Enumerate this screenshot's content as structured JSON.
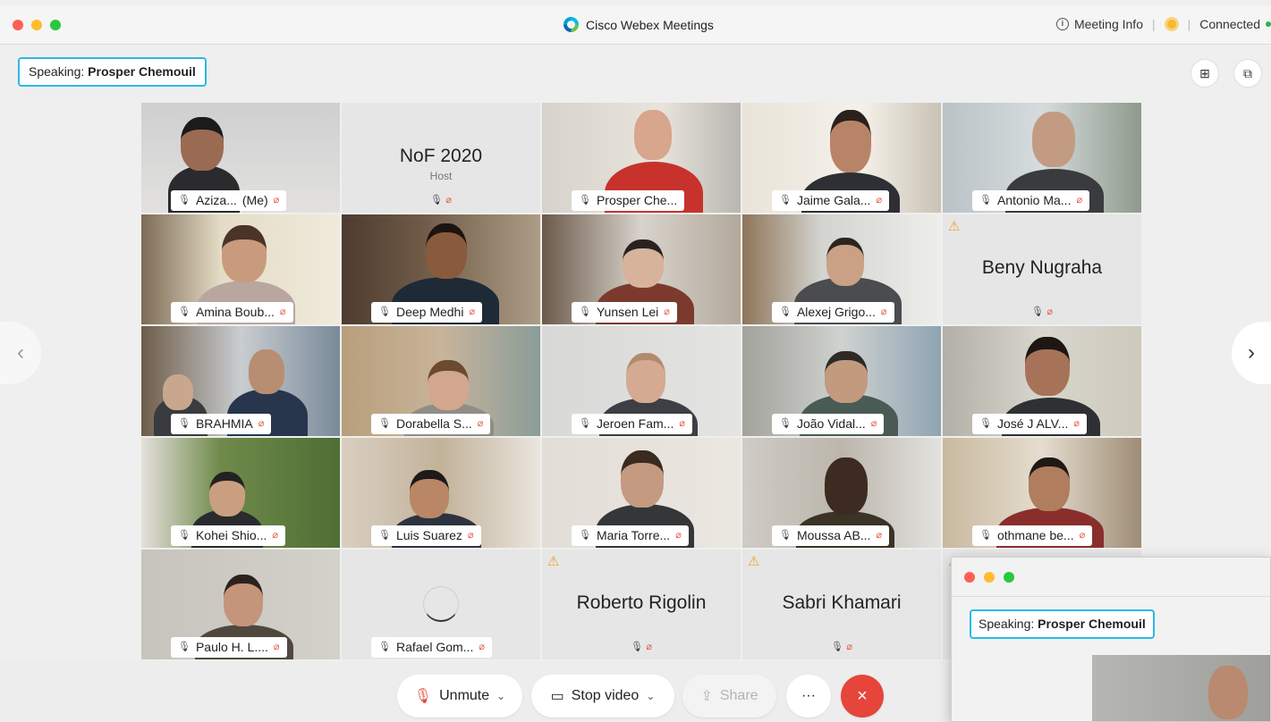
{
  "window": {
    "title": "Cisco Webex Meetings"
  },
  "header": {
    "meeting_info": "Meeting Info",
    "connection_status": "Connected"
  },
  "speaking": {
    "label": "Speaking:",
    "name": "Prosper Chemouil"
  },
  "participants": [
    {
      "name": "Aziza...",
      "suffix": "(Me)"
    },
    {
      "name": "NoF 2020",
      "role": "Host"
    },
    {
      "name": "Prosper Che..."
    },
    {
      "name": "Jaime Gala..."
    },
    {
      "name": "Antonio Ma..."
    },
    {
      "name": "Amina Boub..."
    },
    {
      "name": "Deep Medhi"
    },
    {
      "name": "Yunsen Lei"
    },
    {
      "name": "Alexej Grigo..."
    },
    {
      "name": "Beny Nugraha"
    },
    {
      "name": "BRAHMIA"
    },
    {
      "name": "Dorabella S..."
    },
    {
      "name": "Jeroen Fam..."
    },
    {
      "name": "João Vidal..."
    },
    {
      "name": "José J ALV..."
    },
    {
      "name": "Kohei Shio..."
    },
    {
      "name": "Luis Suarez"
    },
    {
      "name": "Maria Torre..."
    },
    {
      "name": "Moussa AB..."
    },
    {
      "name": "othmane be..."
    },
    {
      "name": "Paulo H. L...."
    },
    {
      "name": "Rafael Gom..."
    },
    {
      "name": "Roberto Rigolin"
    },
    {
      "name": "Sabri Khamari"
    }
  ],
  "toolbar": {
    "unmute": "Unmute",
    "stop_video": "Stop video",
    "share": "Share",
    "more": "···",
    "leave": "×"
  },
  "mini_window": {
    "speaking_label": "Speaking:",
    "speaking_name": "Prosper Chemouil"
  },
  "icons": {
    "mic": "mic-icon",
    "muted": "muted-mic-icon",
    "warning": "warning-icon",
    "grid": "grid-layout-icon",
    "popout": "popout-icon"
  },
  "colors": {
    "accent": "#27b5ec",
    "leave": "#e6453a",
    "muted": "#e3593f",
    "warning": "#e9a426"
  }
}
